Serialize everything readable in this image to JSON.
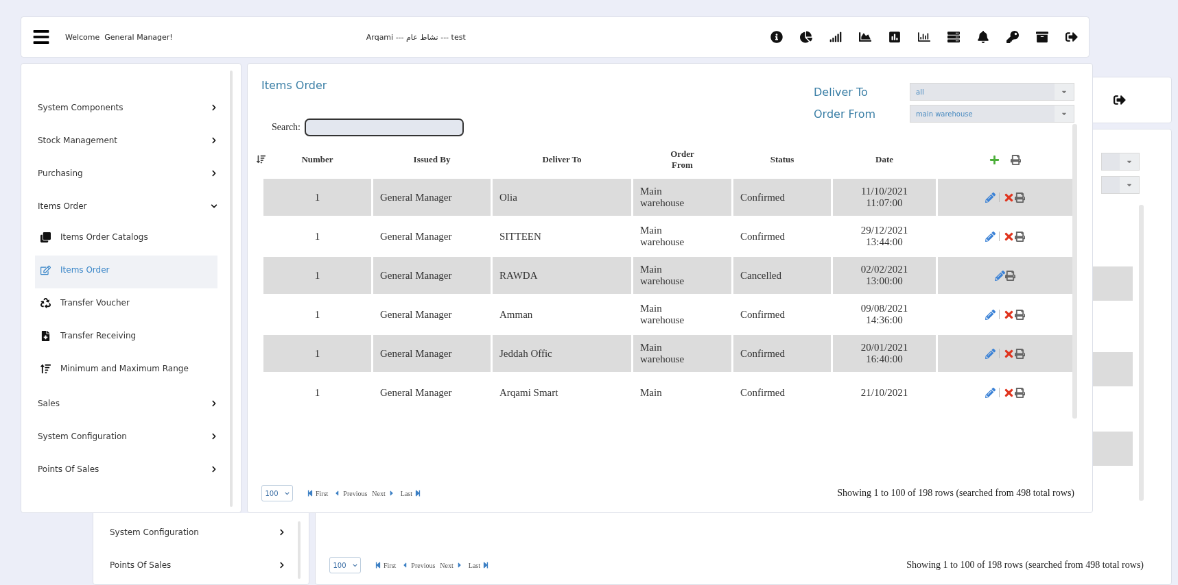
{
  "header": {
    "welcome": "Welcome  General Manager!",
    "context": "Arqami --- نشاط عام --- test"
  },
  "sidebar": {
    "items": [
      {
        "label": "System Components",
        "expanded": false
      },
      {
        "label": "Stock Management",
        "expanded": false
      },
      {
        "label": "Purchasing",
        "expanded": false
      },
      {
        "label": "Items Order",
        "expanded": true,
        "children": [
          {
            "label": "Items Order Catalogs",
            "selected": false
          },
          {
            "label": "Items Order",
            "selected": true
          },
          {
            "label": "Transfer Voucher",
            "selected": false
          },
          {
            "label": "Transfer Receiving",
            "selected": false
          },
          {
            "label": "Minimum and Maximum Range",
            "selected": false
          }
        ]
      },
      {
        "label": "Sales",
        "expanded": false
      },
      {
        "label": "System Configuration",
        "expanded": false
      },
      {
        "label": "Points Of Sales",
        "expanded": false
      }
    ]
  },
  "page": {
    "title": "Items Order",
    "filters": [
      {
        "label": "Deliver To",
        "value": "all"
      },
      {
        "label": "Order From",
        "value": "main warehouse"
      }
    ],
    "search": {
      "label": "Search:"
    },
    "table": {
      "columns": [
        "Number",
        "Issued By",
        "Deliver To",
        "Order From",
        "Status",
        "Date"
      ],
      "rows": [
        {
          "number": "1",
          "issued_by": "General Manager",
          "deliver_to": "Olia",
          "order_from": "Main warehouse",
          "status": "Confirmed",
          "date": "11/10/2021 11:07:00",
          "deletable": true
        },
        {
          "number": "1",
          "issued_by": "General Manager",
          "deliver_to": "SITTEEN",
          "order_from": "Main warehouse",
          "status": "Confirmed",
          "date": "29/12/2021 13:44:00",
          "deletable": true
        },
        {
          "number": "1",
          "issued_by": "General Manager",
          "deliver_to": "RAWDA",
          "order_from": "Main warehouse",
          "status": "Cancelled",
          "date": "02/02/2021 13:00:00",
          "deletable": false
        },
        {
          "number": "1",
          "issued_by": "General Manager",
          "deliver_to": "Amman",
          "order_from": "Main warehouse",
          "status": "Confirmed",
          "date": "09/08/2021 14:36:00",
          "deletable": true
        },
        {
          "number": "1",
          "issued_by": "General Manager",
          "deliver_to": "Jeddah Offic",
          "order_from": "Main warehouse",
          "status": "Confirmed",
          "date": "20/01/2021 16:40:00",
          "deletable": true
        },
        {
          "number": "1",
          "issued_by": "General Manager",
          "deliver_to": "Arqami Smart",
          "order_from": "Main",
          "status": "Confirmed",
          "date": "21/10/2021",
          "deletable": true
        }
      ]
    },
    "pagination": {
      "page_size": "100",
      "first": "First",
      "previous": "Previous",
      "next": "Next",
      "last": "Last",
      "summary": "Showing 1 to 100 of 198 rows (searched from 498 total rows)"
    }
  },
  "back_window": {
    "sidebar_items": [
      {
        "label": "System Configuration",
        "expanded": false
      },
      {
        "label": "Points Of Sales",
        "expanded": false
      }
    ],
    "pagination": {
      "page_size": "100",
      "first": "First",
      "previous": "Previous",
      "next": "Next",
      "last": "Last",
      "summary": "Showing 1 to 100 of 198 rows (searched from 498 total rows)"
    }
  }
}
